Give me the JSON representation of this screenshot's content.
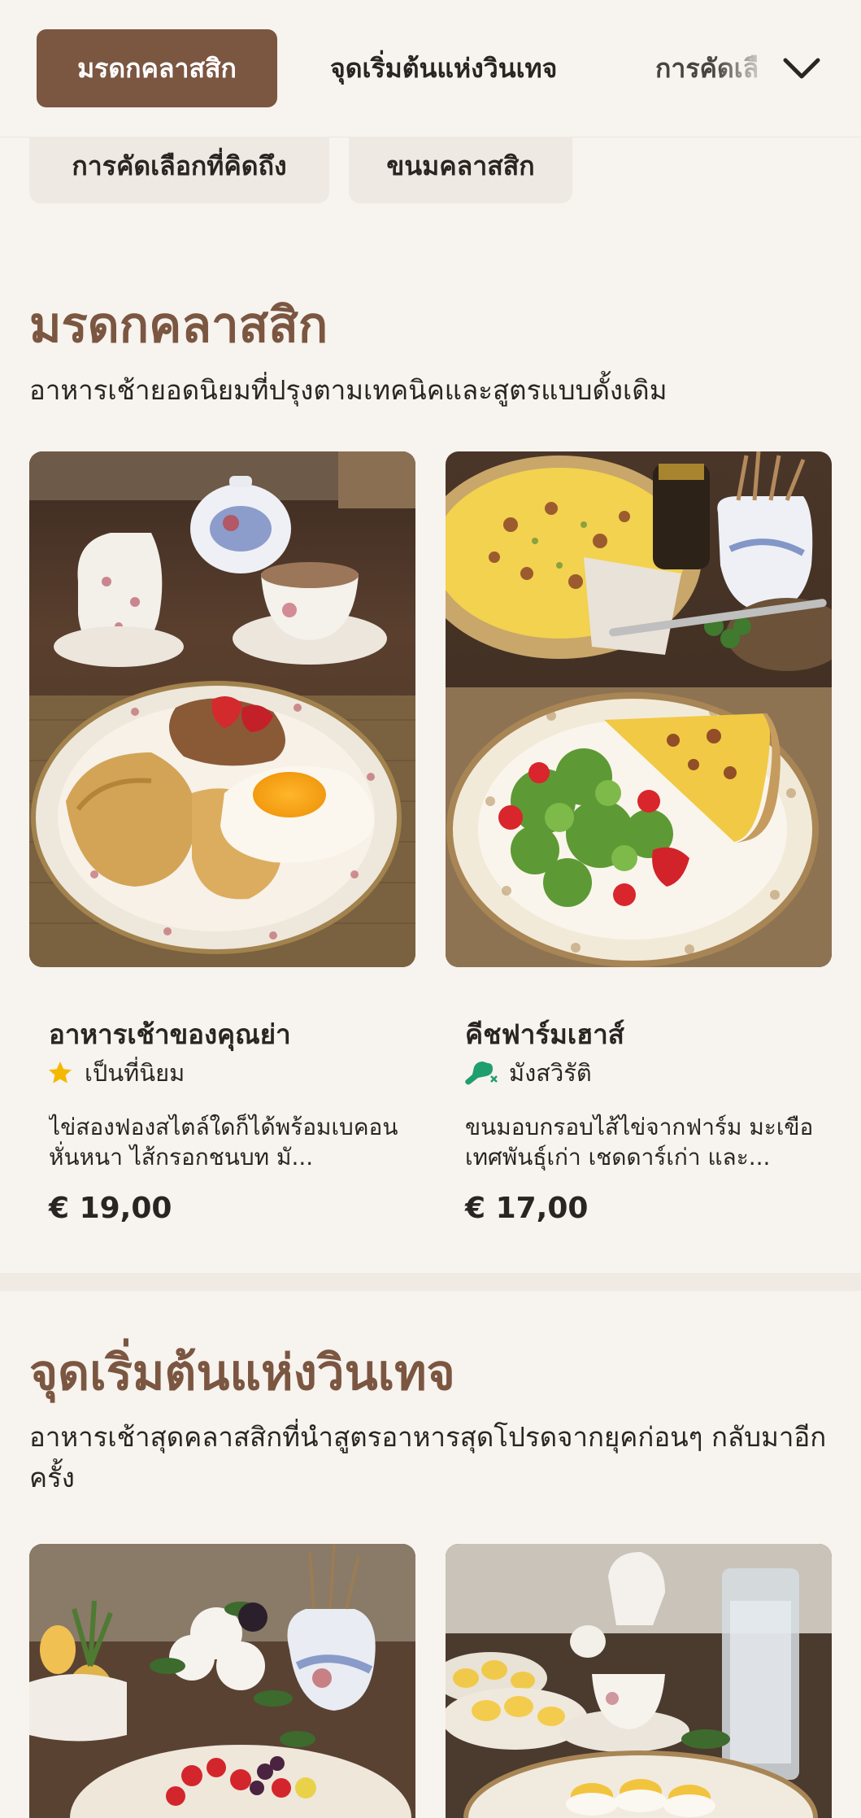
{
  "nav": {
    "tabs": [
      {
        "label": "มรดกคลาสสิก",
        "active": true
      },
      {
        "label": "จุดเริ่มต้นแห่งวินเทจ",
        "active": false
      },
      {
        "label": "การคัดเลื",
        "active": false
      }
    ],
    "more_icon": "chevron-down-icon",
    "chips": [
      {
        "label": "การคัดเลือกที่คิดถึง"
      },
      {
        "label": "ขนมคลาสสิก"
      }
    ]
  },
  "sections": [
    {
      "title": "มรดกคลาสสิก",
      "subtitle": "อาหารเช้ายอดนิยมที่ปรุงตามเทคนิคและสูตรแบบดั้งเดิม",
      "items": [
        {
          "name": "อาหารเช้าของคุณย่า",
          "tag": "เป็นที่นิยม",
          "tag_icon": "star-icon",
          "description": "ไข่สองฟองสไตล์ใดก็ได้พร้อมเบคอนหั่นหนา ไส้กรอกชนบท มั...",
          "price": "€ 19,00"
        },
        {
          "name": "คีชฟาร์มเฮาส์",
          "tag": "มังสวิรัติ",
          "tag_icon": "vegetarian-drumstick-icon",
          "description": "ขนมอบกรอบไส้ไข่จากฟาร์ม มะเขือเทศพันธุ์เก่า เชดดาร์เก่า และ...",
          "price": "€ 17,00"
        }
      ]
    },
    {
      "title": "จุดเริ่มต้นแห่งวินเทจ",
      "subtitle": "อาหารเช้าสุดคลาสสิกที่นำสูตรอาหารสุดโปรดจากยุคก่อนๆ กลับมาอีกครั้ง",
      "items": []
    }
  ],
  "colors": {
    "accent": "#7b5641",
    "background": "#f7f3ee",
    "star": "#f5b800",
    "vegetarian": "#1f9e6e"
  }
}
